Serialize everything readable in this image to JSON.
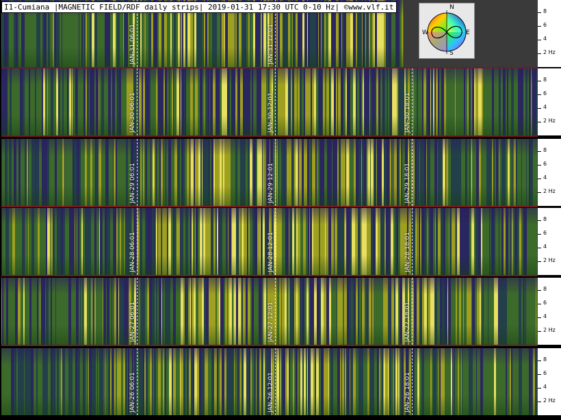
{
  "title": "I1-Cumiana |MAGNETIC FIELD/RDF daily strips| 2019-01-31 17:30 UTC 0-10 Hz| ©www.vlf.it",
  "compass": {
    "n": "N",
    "s": "S",
    "e": "E",
    "w": "W"
  },
  "freq_ticks": [
    "8",
    "6",
    "4",
    "2 Hz"
  ],
  "colors": {
    "separator": "#7a1a1a",
    "scale_bg": "#ffffff",
    "title_bg": "#ffffff"
  },
  "strips": [
    {
      "date": "JAN-31",
      "progress": 0.75,
      "markers": [
        "JAN-31 06:01",
        "JAN-31 12:01"
      ]
    },
    {
      "date": "JAN-30",
      "progress": 1.0,
      "markers": [
        "JAN-30 06:01",
        "JAN-30 12:01",
        "JAN-30 18:01"
      ]
    },
    {
      "date": "JAN-29",
      "progress": 1.0,
      "markers": [
        "JAN-29 06:01",
        "JAN-29 12:01",
        "JAN-29 18:01"
      ]
    },
    {
      "date": "JAN-28",
      "progress": 1.0,
      "markers": [
        "JAN-28 06:01",
        "JAN-28 12:01",
        "JAN-28 18:01"
      ]
    },
    {
      "date": "JAN-27",
      "progress": 1.0,
      "markers": [
        "JAN-27 06:01",
        "JAN-27 12:01",
        "JAN-27 18:01"
      ]
    },
    {
      "date": "JAN-26",
      "progress": 1.0,
      "markers": [
        "JAN-26 06:01",
        "JAN-26 12:01",
        "JAN-26 18:01"
      ]
    }
  ]
}
